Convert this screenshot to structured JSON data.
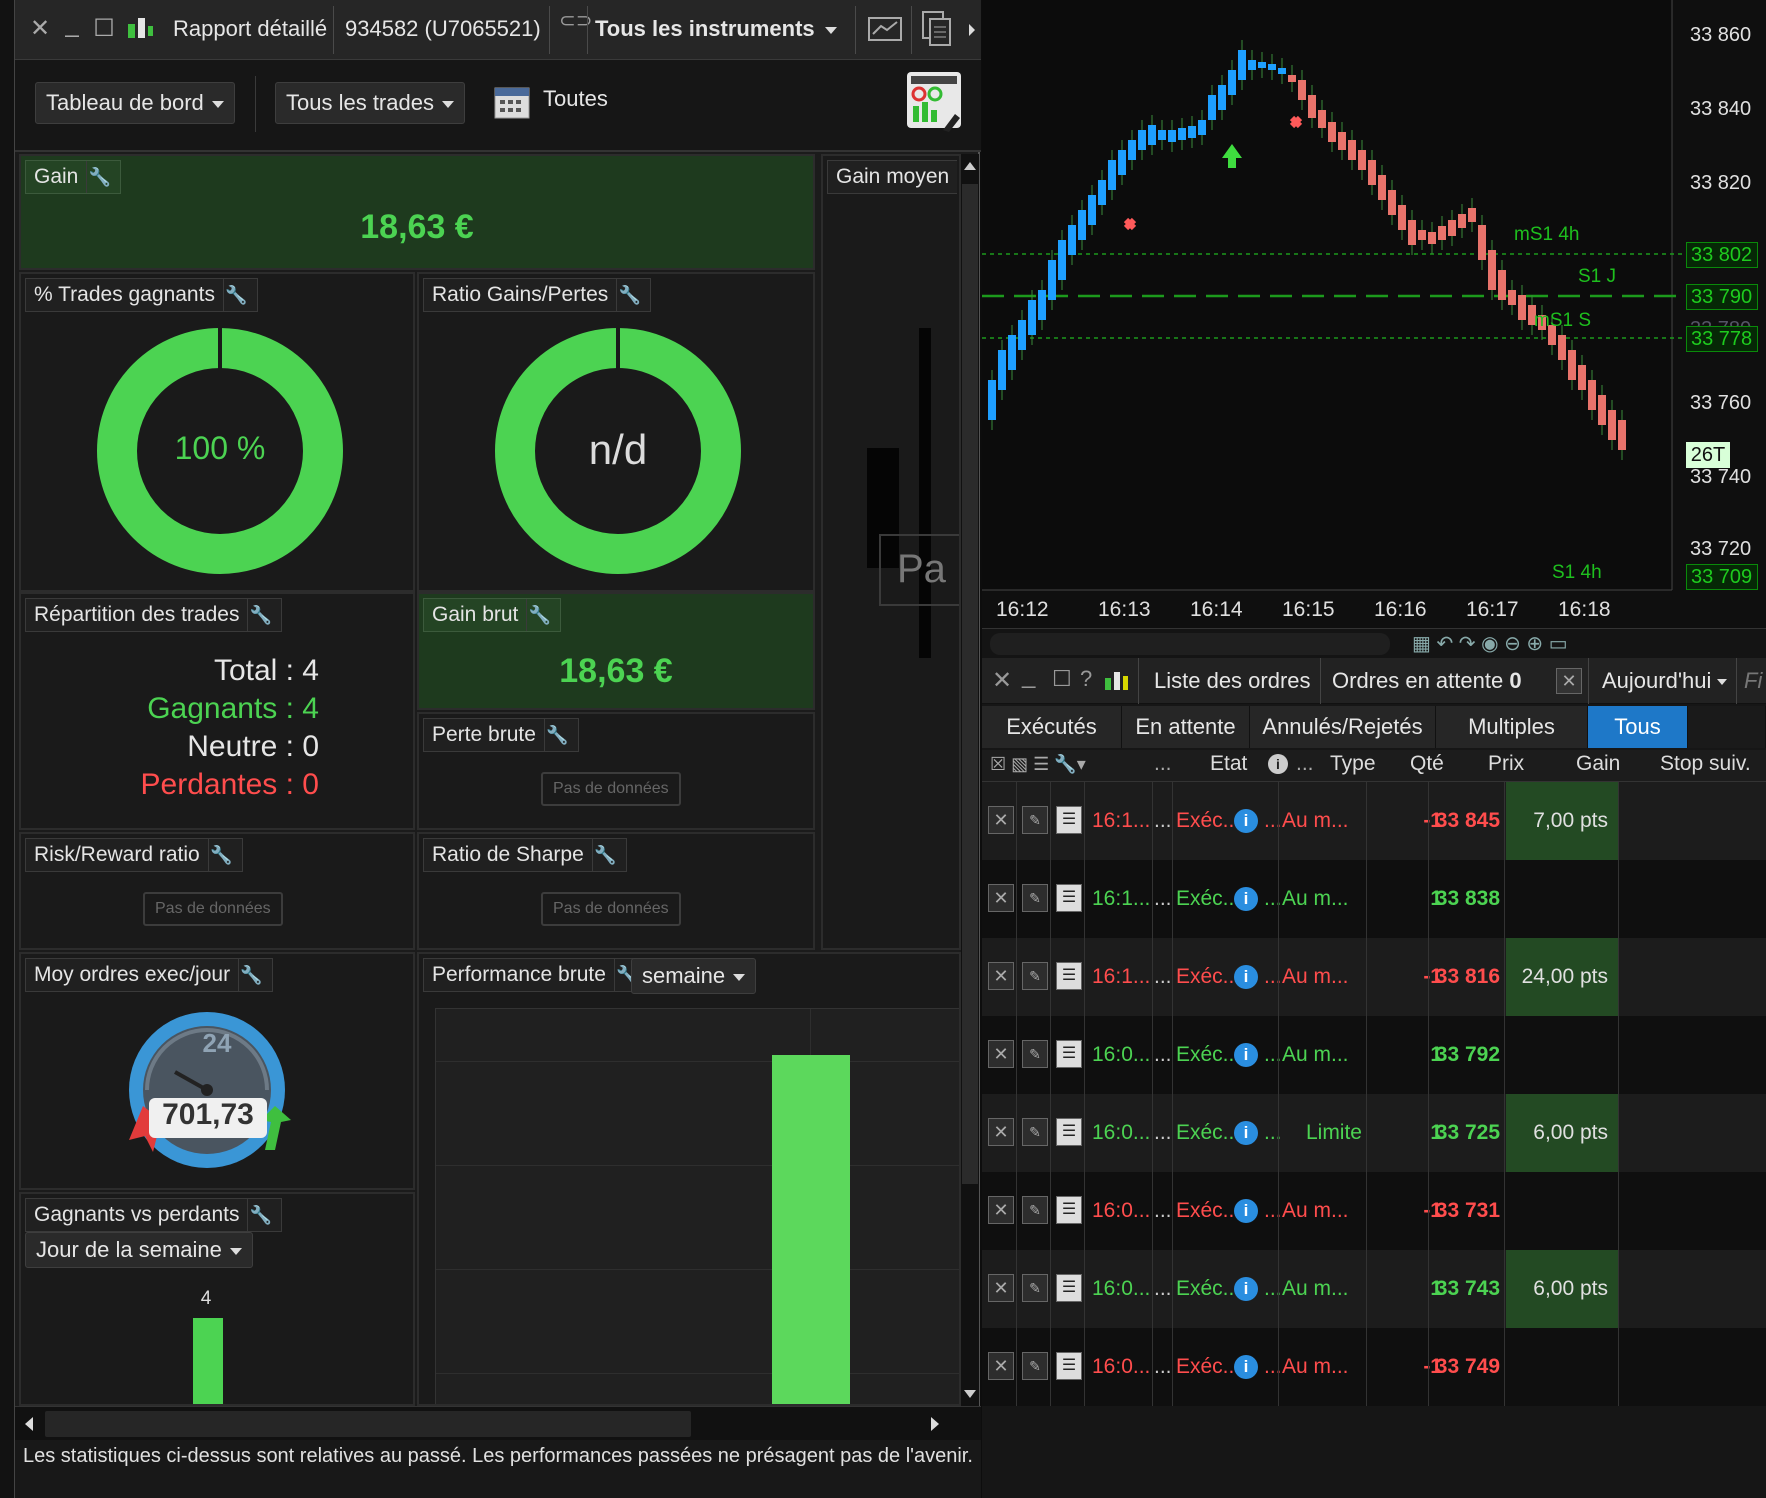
{
  "report": {
    "title": "Rapport détaillé",
    "account": "934582 (U7065521)",
    "instrument": "Tous les instruments",
    "toolbar": {
      "dashboard": "Tableau de bord",
      "trades": "Tous les trades",
      "period": "Toutes"
    },
    "gain": {
      "label": "Gain",
      "value": "18,63 €"
    },
    "gain_moyen": {
      "label": "Gain moyen",
      "partial_text": "Pa"
    },
    "winning_pct": {
      "label": "% Trades gagnants",
      "value": "100 %"
    },
    "ratio": {
      "label": "Ratio Gains/Pertes",
      "value": "n/d"
    },
    "repartition": {
      "label": "Répartition des trades",
      "total": "Total : 4",
      "gagnants": "Gagnants : 4",
      "neutre": "Neutre : 0",
      "perdantes": "Perdantes : 0"
    },
    "gain_brut": {
      "label": "Gain brut",
      "value": "18,63 €"
    },
    "perte_brute": {
      "label": "Perte brute",
      "nodata": "Pas de données"
    },
    "risk_reward": {
      "label": "Risk/Reward ratio",
      "nodata": "Pas de données"
    },
    "sharpe": {
      "label": "Ratio de Sharpe",
      "nodata": "Pas de données"
    },
    "moy_ordres": {
      "label": "Moy ordres exec/jour",
      "dial_value": "24",
      "value": "701,73"
    },
    "performance": {
      "label": "Performance brute",
      "period": "semaine"
    },
    "gvp": {
      "label": "Gagnants vs perdants",
      "period": "Jour de la semaine",
      "bar_label": "4"
    },
    "footer": "Les statistiques ci-dessus sont relatives au passé. Les performances passées ne présagent pas de l'avenir."
  },
  "chart": {
    "price_labels": [
      "33 860",
      "33 840",
      "33 820",
      "33 760",
      "33 740",
      "33 720"
    ],
    "price_boxes": [
      "33 802",
      "33 790",
      "33 778",
      "33 709"
    ],
    "partial_price_label": "33 780",
    "current_tag": "26T",
    "time_labels": [
      "16:12",
      "16:13",
      "16:14",
      "16:15",
      "16:16",
      "16:17",
      "16:18"
    ],
    "annotations": {
      "ms1_4h": "mS1 4h",
      "s1_j": "S1 J",
      "ms1_s": "mS1 S",
      "s1_4h": "S1 4h"
    }
  },
  "orders": {
    "header": {
      "title": "Liste des ordres",
      "pending_label": "Ordres en attente",
      "pending_count": "0",
      "period": "Aujourd'hui",
      "partial": "Fi"
    },
    "tabs": [
      "Exécutés",
      "En attente",
      "Annulés/Rejetés",
      "Multiples",
      "Tous"
    ],
    "active_tab": "Tous",
    "columns": {
      "etat": "Etat",
      "type": "Type",
      "qte": "Qté",
      "prix": "Prix",
      "gain": "Gain",
      "stop": "Stop suiv.",
      "dots1": "...",
      "dots2": "..."
    },
    "rows": [
      {
        "time": "16:1...",
        "dots": "...",
        "etat": "Exéc...",
        "pre": "...",
        "type": "Au m...",
        "qte": "-1",
        "prix": "33 845",
        "gain": "7,00 pts",
        "side": "sell"
      },
      {
        "time": "16:1...",
        "dots": "...",
        "etat": "Exéc...",
        "pre": "...",
        "type": "Au m...",
        "qte": "1",
        "prix": "33 838",
        "gain": "",
        "side": "buy"
      },
      {
        "time": "16:1...",
        "dots": "...",
        "etat": "Exéc...",
        "pre": "...",
        "type": "Au m...",
        "qte": "-1",
        "prix": "33 816",
        "gain": "24,00 pts",
        "side": "sell"
      },
      {
        "time": "16:0...",
        "dots": "...",
        "etat": "Exéc...",
        "pre": "...",
        "type": "Au m...",
        "qte": "1",
        "prix": "33 792",
        "gain": "",
        "side": "buy"
      },
      {
        "time": "16:0...",
        "dots": "...",
        "etat": "Exéc...",
        "pre": "...",
        "type": "Limite",
        "qte": "1",
        "prix": "33 725",
        "gain": "6,00 pts",
        "side": "buy"
      },
      {
        "time": "16:0...",
        "dots": "...",
        "etat": "Exéc...",
        "pre": "...",
        "type": "Au m...",
        "qte": "-1",
        "prix": "33 731",
        "gain": "",
        "side": "sell"
      },
      {
        "time": "16:0...",
        "dots": "...",
        "etat": "Exéc...",
        "pre": "...",
        "type": "Au m...",
        "qte": "1",
        "prix": "33 743",
        "gain": "6,00 pts",
        "side": "buy"
      },
      {
        "time": "16:0...",
        "dots": "...",
        "etat": "Exéc...",
        "pre": "...",
        "type": "Au m...",
        "qte": "-1",
        "prix": "33 749",
        "gain": "",
        "side": "sell"
      }
    ]
  },
  "colors": {
    "green": "#4cd352",
    "red": "#ff4d4d",
    "accent_blue": "#1e78c8",
    "candle_up": "#1e9fff",
    "candle_down": "#e8736b"
  }
}
